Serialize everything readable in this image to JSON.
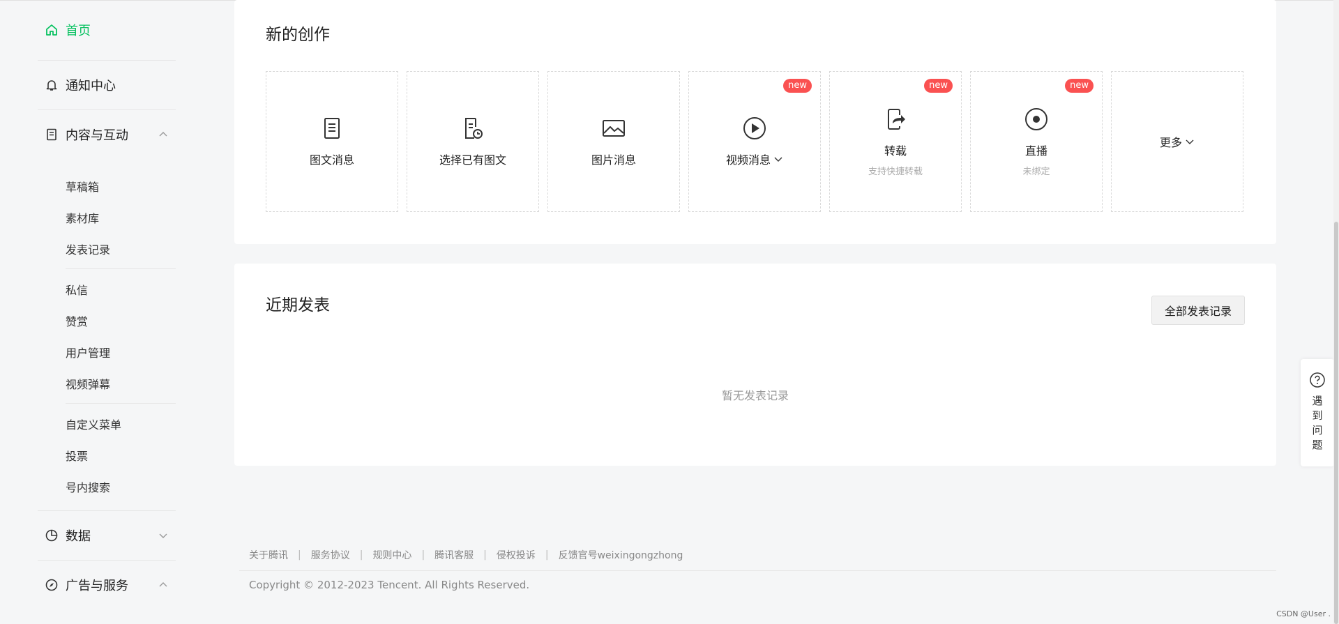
{
  "sidebar": {
    "home": "首页",
    "notifications": "通知中心",
    "content": {
      "label": "内容与互动",
      "group1": [
        "草稿箱",
        "素材库",
        "发表记录"
      ],
      "group2": [
        "私信",
        "赞赏",
        "用户管理",
        "视频弹幕"
      ],
      "group3": [
        "自定义菜单",
        "投票",
        "号内搜索"
      ]
    },
    "data": "数据",
    "ads": "广告与服务"
  },
  "create_section": {
    "title": "新的创作",
    "tiles": [
      {
        "label": "图文消息",
        "icon": "doc-icon"
      },
      {
        "label": "选择已有图文",
        "icon": "doc-clock-icon"
      },
      {
        "label": "图片消息",
        "icon": "image-icon"
      },
      {
        "label": "视频消息",
        "icon": "play-icon",
        "badge": "new"
      },
      {
        "label": "转载",
        "sub": "支持快捷转载",
        "icon": "share-icon",
        "badge": "new"
      },
      {
        "label": "直播",
        "sub": "未绑定",
        "icon": "live-icon",
        "badge": "new"
      }
    ],
    "more": "更多"
  },
  "recent_section": {
    "title": "近期发表",
    "all_button": "全部发表记录",
    "empty": "暂无发表记录"
  },
  "footer": {
    "links": [
      "关于腾讯",
      "服务协议",
      "规则中心",
      "腾讯客服",
      "侵权投诉",
      "反馈官号weixingongzhong"
    ],
    "separator": "|",
    "copyright": "Copyright © 2012-2023 Tencent. All Rights Reserved."
  },
  "help": {
    "text": "遇到问题"
  },
  "watermark": "CSDN @User .",
  "colors": {
    "accent": "#07c160",
    "badge": "#fa5151"
  }
}
